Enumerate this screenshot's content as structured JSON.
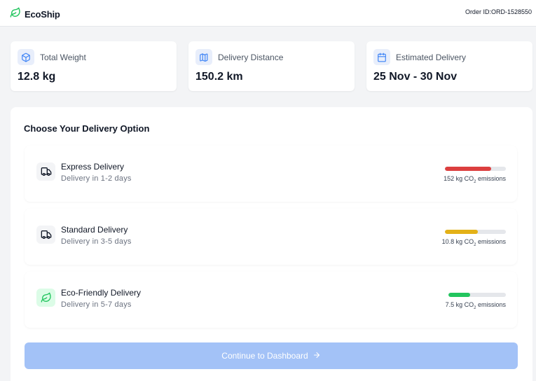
{
  "header": {
    "brand": "EcoShip",
    "order_label": "Order ID:",
    "order_id": "ORD-1528550"
  },
  "stats": [
    {
      "label": "Total Weight",
      "value": "12.8 kg",
      "icon": "package-icon"
    },
    {
      "label": "Delivery Distance",
      "value": "150.2 km",
      "icon": "map-icon"
    },
    {
      "label": "Estimated Delivery",
      "value": "25 Nov - 30 Nov",
      "icon": "calendar-icon"
    }
  ],
  "options_title": "Choose Your Delivery Option",
  "options": [
    {
      "name": "Express Delivery",
      "time": "Delivery in 1-2 days",
      "emissions_value": "152",
      "emissions_unit_prefix": "kg CO",
      "emissions_unit_sub": "2",
      "emissions_suffix": " emissions",
      "emission_level": 0.76,
      "bar_color": "#dc3f3f",
      "icon": "truck-icon"
    },
    {
      "name": "Standard Delivery",
      "time": "Delivery in 3-5 days",
      "emissions_value": "10.8",
      "emissions_unit_prefix": "kg CO",
      "emissions_unit_sub": "2",
      "emissions_suffix": " emissions",
      "emission_level": 0.54,
      "bar_color": "#e3b117",
      "icon": "truck-icon"
    },
    {
      "name": "Eco-Friendly Delivery",
      "time": "Delivery in 5-7 days",
      "emissions_value": "7.5",
      "emissions_unit_prefix": "kg CO",
      "emissions_unit_sub": "2",
      "emissions_suffix": " emissions",
      "emission_level": 0.38,
      "bar_color": "#22c55e",
      "icon": "leaf-icon"
    }
  ],
  "cta": {
    "label": "Continue to Dashboard",
    "icon": "arrow-right-icon"
  },
  "colors": {
    "brand_green": "#22c55e",
    "accent_blue": "#3b82f6",
    "cta_disabled": "#a3c2f7"
  }
}
